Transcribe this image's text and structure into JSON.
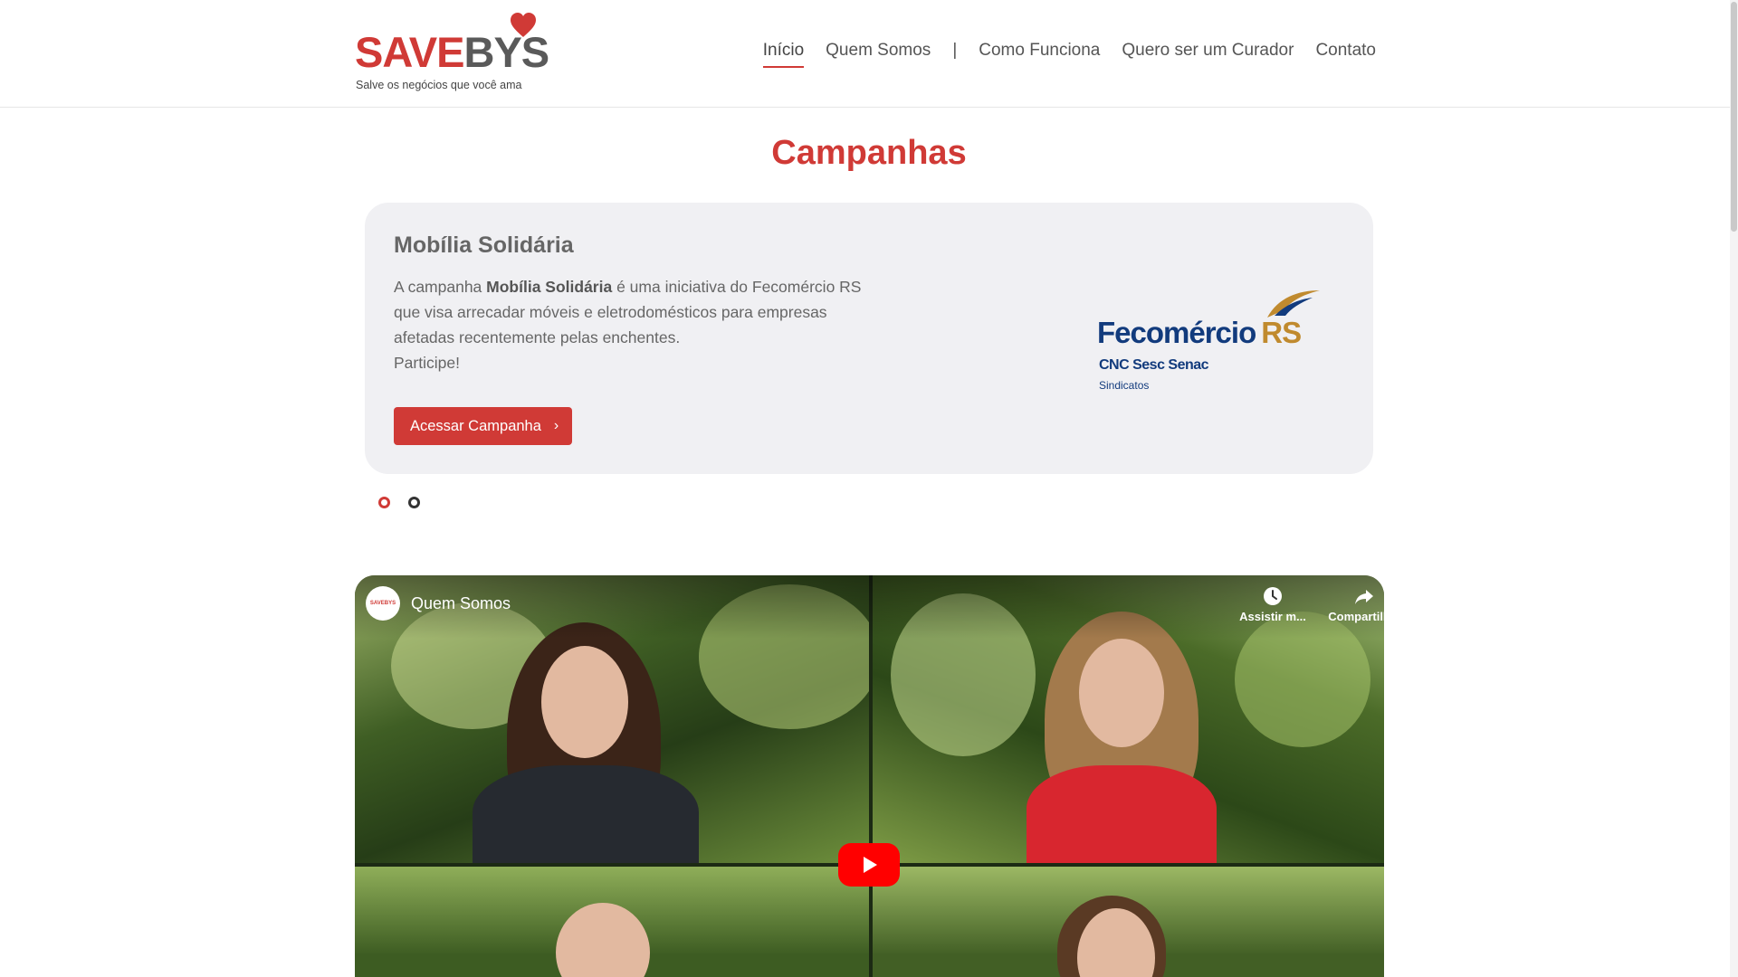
{
  "brand": {
    "logo_text_save": "SAVE",
    "logo_text_bys": "BYS",
    "tagline": "Salve os negócios que você ama",
    "accent_color": "#d03a36"
  },
  "nav": {
    "items": [
      {
        "label": "Início",
        "active": true
      },
      {
        "label": "Quem Somos"
      },
      {
        "label": "|"
      },
      {
        "label": "Como Funciona"
      },
      {
        "label": "Quero ser um Curador"
      },
      {
        "label": "Contato"
      }
    ]
  },
  "campaigns": {
    "section_title": "Campanhas",
    "card": {
      "title": "Mobília Solidária",
      "desc_prefix": "A campanha ",
      "desc_bold": "Mobília Solidária",
      "desc_suffix": " é uma iniciativa do Fecomércio RS que visa arrecadar móveis e eletrodomésticos para empresas afetadas recentemente pelas enchentes.",
      "desc_cta_line": "Participe!",
      "button_label": "Acessar Campanha",
      "button_icon": "chevron-right-icon",
      "partner": {
        "name": "Fecomércio",
        "name_suffix": "RS",
        "sub_brands": "CNC Sesc Senac",
        "sub_label": "Sindicatos"
      }
    },
    "carousel": {
      "slide_count": 2,
      "active_index": 0
    }
  },
  "video": {
    "channel_avatar_text": "SAVEBYS",
    "title": "Quem Somos",
    "actions": [
      {
        "label": "Assistir m...",
        "icon": "clock-icon"
      },
      {
        "label": "Compartilh...",
        "icon": "share-icon"
      }
    ],
    "play_icon": "play-icon"
  }
}
